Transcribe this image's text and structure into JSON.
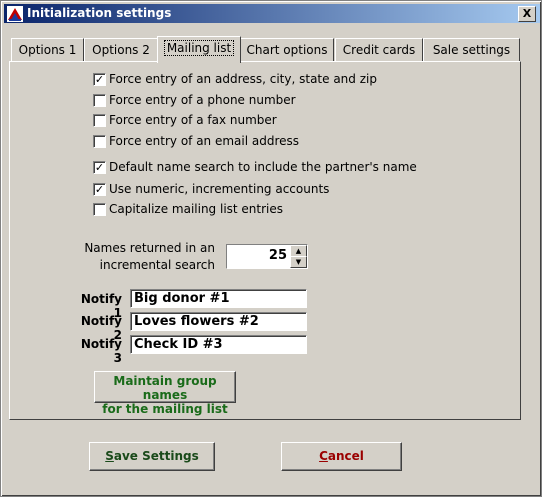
{
  "window": {
    "title": "Initialization settings",
    "close_label": "X"
  },
  "tabs": [
    {
      "label": "Options 1",
      "active": false
    },
    {
      "label": "Options 2",
      "active": false
    },
    {
      "label": "Mailing list",
      "active": true
    },
    {
      "label": "Chart options",
      "active": false
    },
    {
      "label": "Credit cards",
      "active": false
    },
    {
      "label": "Sale settings",
      "active": false
    }
  ],
  "options": [
    {
      "label": "Force entry of an address, city, state and zip",
      "checked": true
    },
    {
      "label": "Force entry of a phone number",
      "checked": false
    },
    {
      "label": "Force entry of a fax number",
      "checked": false
    },
    {
      "label": "Force entry of an email address",
      "checked": false
    },
    {
      "label": "Default name search to include the partner's name",
      "checked": true
    },
    {
      "label": "Use numeric, incrementing accounts",
      "checked": true
    },
    {
      "label": "Capitalize mailing list entries",
      "checked": false
    }
  ],
  "names_returned": {
    "label_line1": "Names returned in an",
    "label_line2": "incremental search",
    "value": "25"
  },
  "notify": [
    {
      "label": "Notify 1",
      "value": "Big donor #1"
    },
    {
      "label": "Notify 2",
      "value": "Loves flowers #2"
    },
    {
      "label": "Notify 3",
      "value": "Check ID #3"
    }
  ],
  "group_button": {
    "line1": "Maintain group names",
    "line2": "for the mailing list"
  },
  "footer": {
    "save_accel": "S",
    "save_rest": "ave Settings",
    "cancel_accel": "C",
    "cancel_rest": "ancel"
  },
  "colors": {
    "titlebar_start": "#0a246a",
    "titlebar_end": "#a6caf0",
    "group_button_text": "#1a6b1a",
    "cancel_text": "#9a0000"
  }
}
